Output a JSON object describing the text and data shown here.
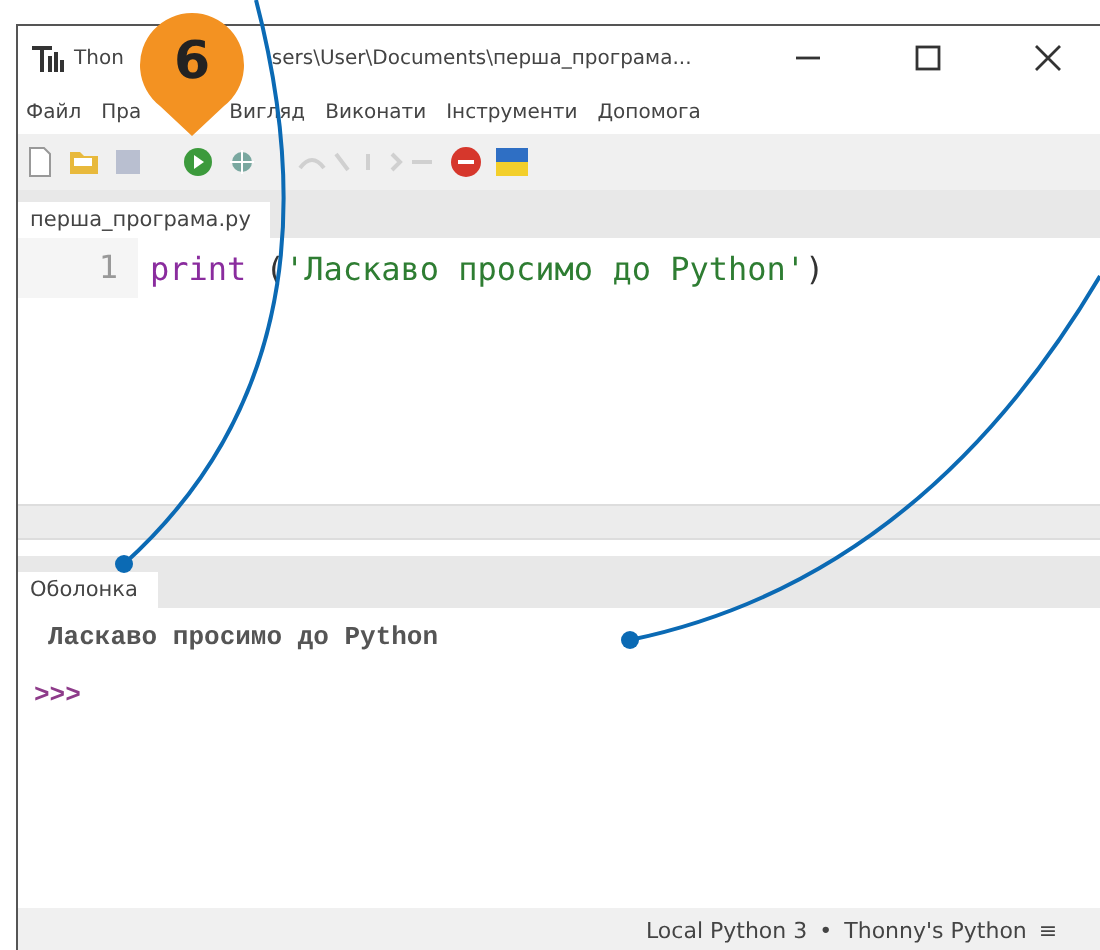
{
  "window": {
    "title_parts": [
      "Thon",
      "sers\\User\\Documents\\перша_програма..."
    ]
  },
  "menu": [
    "Файл",
    "Пра",
    "Вигляд",
    "Виконати",
    "Інструменти",
    "Допомога"
  ],
  "editor": {
    "tab": "перша_програма.py",
    "lines": [
      {
        "number": "1",
        "tokens": [
          {
            "kind": "keyword",
            "text": "print"
          },
          {
            "kind": "plain",
            "text": " ("
          },
          {
            "kind": "string",
            "text": "'Ласкаво просимо до Python'"
          },
          {
            "kind": "plain",
            "text": ")"
          }
        ]
      }
    ]
  },
  "shell": {
    "tab": "Оболонка",
    "output": "Ласкаво просимо до Python",
    "prompt": ">>>"
  },
  "status_bar": {
    "interpreter": "Local Python 3",
    "separator": "•",
    "python": "Thonny's Python",
    "menu": "≡"
  },
  "annotation": {
    "badge": "6"
  }
}
